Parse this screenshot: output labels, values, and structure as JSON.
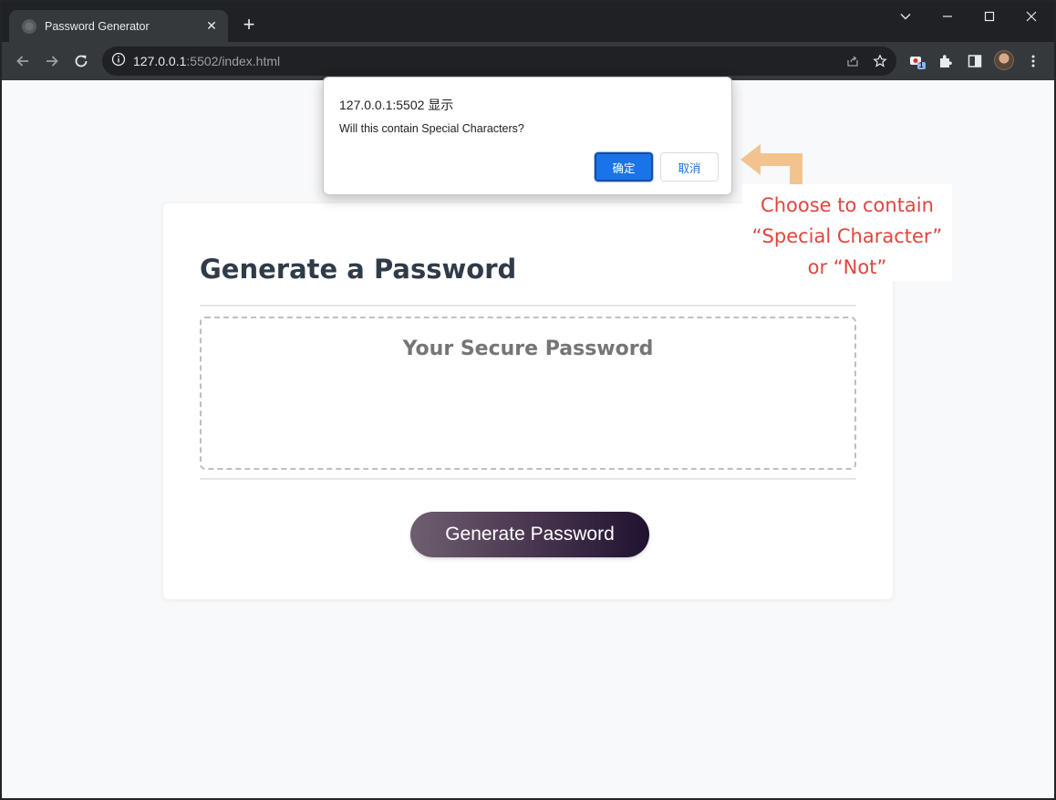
{
  "browser": {
    "tab_title": "Password Generator",
    "new_tab_symbol": "+",
    "tab_close_symbol": "✕",
    "url_host": "127.0.0.1",
    "url_rest": ":5502/index.html",
    "extension_badge": "1"
  },
  "page": {
    "title": "Generate a Password",
    "password_placeholder": "Your Secure Password",
    "generate_button": "Generate Password"
  },
  "dialog": {
    "title": "127.0.0.1:5502 显示",
    "message": "Will this contain Special Characters?",
    "ok_label": "确定",
    "cancel_label": "取消"
  },
  "annotation": {
    "line1": "Choose to contain",
    "line2": "“Special Character”",
    "line3": "or “Not”",
    "color": "#e0453e",
    "arrow_color": "#f2c38f"
  }
}
